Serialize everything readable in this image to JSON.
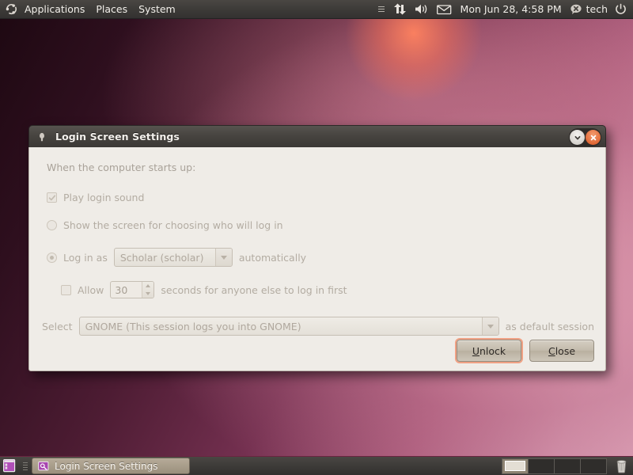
{
  "top_panel": {
    "logo_icon": "ubuntu-logo-icon",
    "menus": [
      {
        "label": "Applications",
        "name": "applications-menu"
      },
      {
        "label": "Places",
        "name": "places-menu"
      },
      {
        "label": "System",
        "name": "system-menu"
      }
    ],
    "tray": [
      {
        "icon": "list-indicator-icon"
      },
      {
        "icon": "network-up-down-icon"
      },
      {
        "icon": "volume-speaker-icon"
      },
      {
        "icon": "envelope-messaging-icon"
      }
    ],
    "clock": "Mon Jun 28,  4:58 PM",
    "user_status_icon": "chat-offline-icon",
    "username": "tech",
    "power_icon": "power-button-icon"
  },
  "dialog": {
    "title": "Login Screen Settings",
    "title_icon": "login-screen-icon",
    "minimize_icon": "chevron-down-icon",
    "close_icon": "close-x-icon",
    "intro": "When the computer starts up:",
    "play_sound": {
      "label": "Play login sound",
      "checked": true,
      "enabled": false,
      "check_glyph": "check-mark-icon"
    },
    "show_chooser": {
      "label": "Show the screen for choosing who will log in",
      "checked": false,
      "enabled": false
    },
    "auto_login": {
      "prefix": "Log in as",
      "suffix": "automatically",
      "selected": true,
      "enabled": false,
      "user_value": "Scholar (scholar)",
      "arrow_icon": "chevron-down-icon"
    },
    "allow_delay": {
      "label": "Allow",
      "checked": false,
      "enabled": false,
      "seconds": "30",
      "suffix": "seconds for anyone else to log in first",
      "up_icon": "spinner-up-icon",
      "down_icon": "spinner-down-icon"
    },
    "default_session": {
      "prefix": "Select",
      "value": "GNOME (This session logs you into GNOME)",
      "suffix": "as default session",
      "arrow_icon": "chevron-down-icon"
    },
    "buttons": {
      "unlock": {
        "label": "Unlock",
        "mnemonic": "U",
        "rest": "nlock",
        "focused": true
      },
      "close": {
        "label": "Close",
        "mnemonic": "C",
        "rest": "lose",
        "focused": false
      }
    }
  },
  "bottom_panel": {
    "show_desktop_icon": "show-desktop-icon",
    "task": {
      "label": "Login Screen Settings",
      "icon": "login-screen-icon"
    },
    "workspaces": {
      "count": 4,
      "active_index": 0
    },
    "trash_icon": "trash-can-icon"
  },
  "colors": {
    "panel_bg": "#3d3b38",
    "dialog_bg": "#efece7",
    "titlebar_bg": "#474440",
    "close_button": "#d9541f",
    "focus_ring": "#f0a184",
    "disabled_text": "#b3aca2",
    "wallpaper_accent": "#dda3b8"
  }
}
